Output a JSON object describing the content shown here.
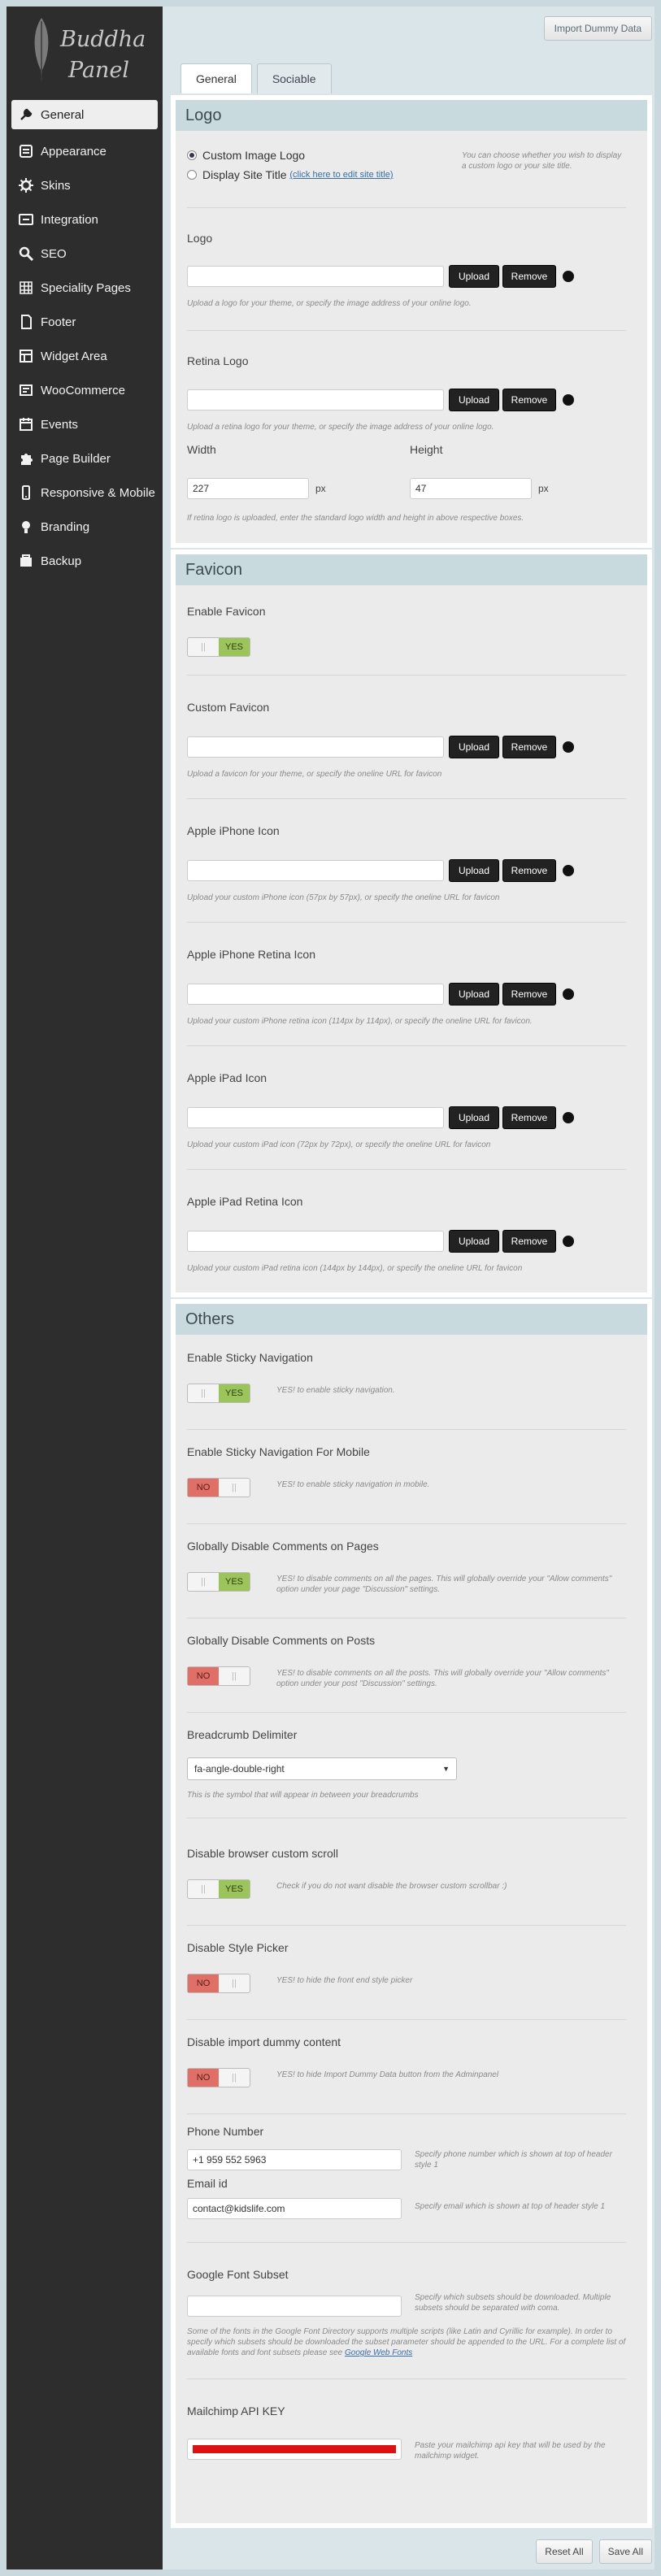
{
  "brand": {
    "line1": "Buddha",
    "line2": "Panel"
  },
  "nav": [
    {
      "label": "General",
      "icon": "wrench-icon"
    },
    {
      "label": "Appearance",
      "icon": "appearance-icon"
    },
    {
      "label": "Skins",
      "icon": "gear-icon"
    },
    {
      "label": "Integration",
      "icon": "integration-icon"
    },
    {
      "label": "SEO",
      "icon": "search-icon"
    },
    {
      "label": "Speciality Pages",
      "icon": "grid-icon"
    },
    {
      "label": "Footer",
      "icon": "footer-icon"
    },
    {
      "label": "Widget Area",
      "icon": "widget-icon"
    },
    {
      "label": "WooCommerce",
      "icon": "woocommerce-icon"
    },
    {
      "label": "Events",
      "icon": "calendar-icon"
    },
    {
      "label": "Page Builder",
      "icon": "puzzle-icon"
    },
    {
      "label": "Responsive & Mobile",
      "icon": "mobile-icon"
    },
    {
      "label": "Branding",
      "icon": "bulb-icon"
    },
    {
      "label": "Backup",
      "icon": "backup-icon"
    }
  ],
  "top": {
    "import": "Import Dummy Data"
  },
  "tabs": [
    "General",
    "Sociable"
  ],
  "logo": {
    "title": "Logo",
    "radio1": "Custom Image Logo",
    "radio2": "Display Site Title",
    "radio2_link": "(click here to edit site title)",
    "radio_desc": "You can choose whether you wish to display a custom logo or your site title.",
    "logo_label": "Logo",
    "logo_desc": "Upload a logo for your theme, or specify the image address of your online logo.",
    "retina_label": "Retina Logo",
    "retina_desc": "Upload a retina logo for your theme, or specify the image address of your online logo.",
    "width_label": "Width",
    "height_label": "Height",
    "width_value": "227",
    "height_value": "47",
    "px": "px",
    "wh_desc": "If retina logo is uploaded, enter the standard logo width and height in above respective boxes."
  },
  "buttons": {
    "upload": "Upload",
    "remove": "Remove"
  },
  "favicon": {
    "title": "Favicon",
    "enable_label": "Enable Favicon",
    "enable_value": "YES",
    "items": [
      {
        "label": "Custom Favicon",
        "desc": "Upload a favicon for your theme, or specify the oneline URL for favicon"
      },
      {
        "label": "Apple iPhone Icon",
        "desc": "Upload your custom iPhone icon (57px by 57px), or specify the oneline URL for favicon"
      },
      {
        "label": "Apple iPhone Retina Icon",
        "desc": "Upload your custom iPhone retina icon (114px by 114px), or specify the oneline URL for favicon."
      },
      {
        "label": "Apple iPad Icon",
        "desc": "Upload your custom iPad icon (72px by 72px), or specify the oneline URL for favicon"
      },
      {
        "label": "Apple iPad Retina Icon",
        "desc": "Upload your custom iPad retina icon (144px by 144px), or specify the oneline URL for favicon"
      }
    ]
  },
  "others": {
    "title": "Others",
    "toggles": [
      {
        "label": "Enable Sticky Navigation",
        "value": "YES",
        "desc": "YES! to enable sticky navigation."
      },
      {
        "label": "Enable Sticky Navigation For Mobile",
        "value": "NO",
        "desc": "YES! to enable sticky navigation in mobile."
      },
      {
        "label": "Globally Disable Comments on Pages",
        "value": "YES",
        "desc": "YES! to disable comments on all the pages. This will globally override your \"Allow comments\" option under your page \"Discussion\" settings."
      },
      {
        "label": "Globally Disable Comments on Posts",
        "value": "NO",
        "desc": "YES! to disable comments on all the posts. This will globally override your \"Allow comments\" option under your post \"Discussion\" settings."
      }
    ],
    "breadcrumb_label": "Breadcrumb Delimiter",
    "breadcrumb_value": "fa-angle-double-right",
    "breadcrumb_desc": "This is the symbol that will appear in between your breadcrumbs",
    "toggles2": [
      {
        "label": "Disable browser custom scroll",
        "value": "YES",
        "desc": "Check if you do not want disable the browser custom scrollbar :)"
      },
      {
        "label": "Disable Style Picker",
        "value": "NO",
        "desc": "YES! to hide the front end style picker"
      },
      {
        "label": "Disable import dummy content",
        "value": "NO",
        "desc": "YES! to hide Import Dummy Data button from the Adminpanel"
      }
    ],
    "phone_label": "Phone Number",
    "phone_value": "+1 959 552 5963",
    "phone_desc": "Specify phone number which is shown at top of header style 1",
    "email_label": "Email id",
    "email_value": "contact@kidslife.com",
    "email_desc": "Specify email which is shown at top of header style 1",
    "font_label": "Google Font Subset",
    "font_desc": "Specify which subsets should be downloaded. Multiple subsets should be separated with coma.",
    "font_note": "Some of the fonts in the Google Font Directory supports multiple scripts (like Latin and Cyrillic for example). In order to specify which subsets should be downloaded the subset parameter should be appended to the URL. For a complete list of available fonts and font subsets please see",
    "font_link": "Google Web Fonts",
    "mailchimp_label": "Mailchimp API KEY",
    "mailchimp_desc": "Paste your mailchimp api key that will be used by the mailchimp widget."
  },
  "footer": {
    "reset": "Reset All",
    "save": "Save All"
  },
  "colors": {
    "toggle_yes": "#9bc45a",
    "toggle_no": "#e07067",
    "redacted": "#dd1111"
  }
}
